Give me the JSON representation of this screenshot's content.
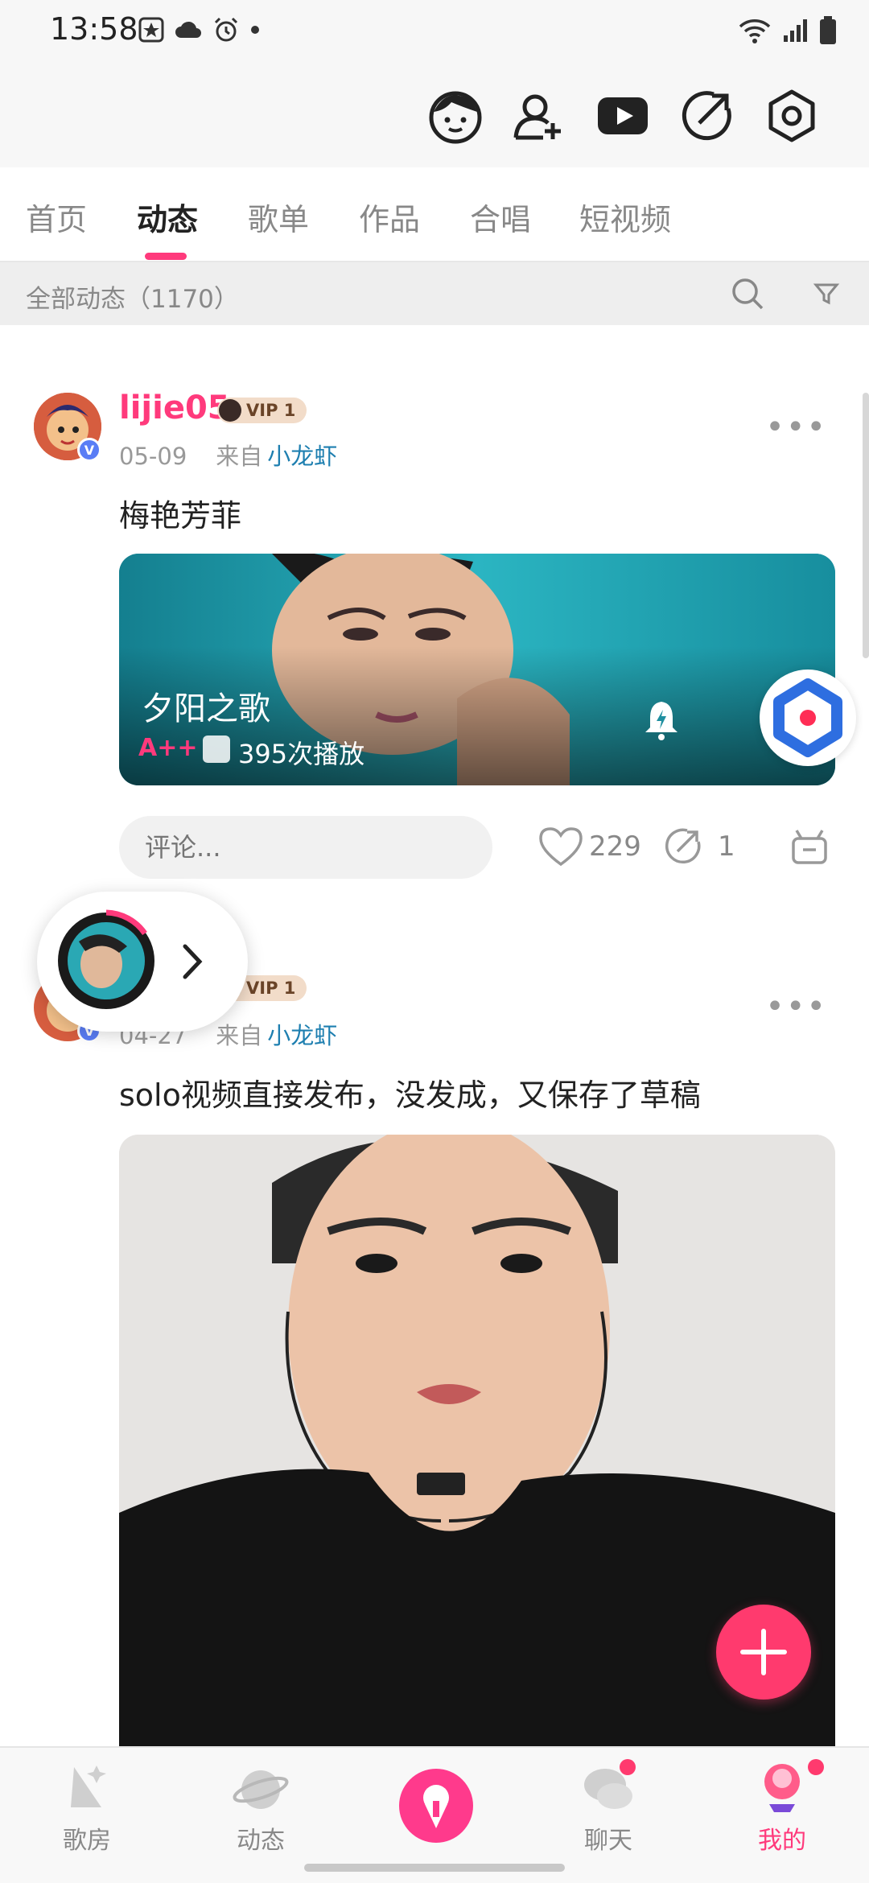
{
  "status": {
    "time": "13:58"
  },
  "tabs": [
    {
      "label": "首页"
    },
    {
      "label": "动态"
    },
    {
      "label": "歌单"
    },
    {
      "label": "作品"
    },
    {
      "label": "合唱"
    },
    {
      "label": "短视频"
    }
  ],
  "filter": {
    "label": "全部动态（1170）"
  },
  "posts": [
    {
      "username": "lijie05",
      "vip": "VIP 1",
      "date": "05-09",
      "from_label": "来自",
      "source": "小龙虾",
      "text": "梅艳芳菲",
      "song": {
        "title": "夕阳之歌",
        "grade": "A++",
        "plays": "395次播放"
      },
      "comment_placeholder": "评论...",
      "likes": "229",
      "shares": "1"
    },
    {
      "vip": "VIP 1",
      "date": "04-27",
      "from_label": "来自",
      "source": "小龙虾",
      "text": "solo视频直接发布，没发成，又保存了草稿"
    }
  ],
  "bottom_nav": [
    {
      "label": "歌房"
    },
    {
      "label": "动态"
    },
    {
      "label": "聊天"
    },
    {
      "label": "我的"
    }
  ],
  "colors": {
    "accent": "#ff3a7c",
    "source_link": "#1e7fb0"
  }
}
